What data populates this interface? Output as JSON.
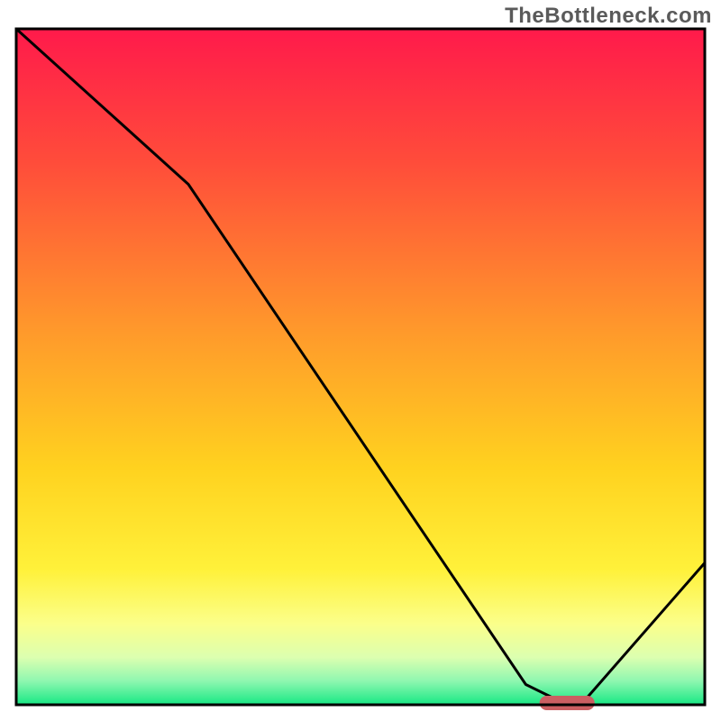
{
  "watermark": "TheBottleneck.com",
  "chart_data": {
    "type": "line",
    "title": "",
    "xlabel": "",
    "ylabel": "",
    "xlim": [
      0,
      100
    ],
    "ylim": [
      0,
      100
    ],
    "x": [
      0,
      25,
      74,
      80,
      82,
      100
    ],
    "values": [
      100,
      77,
      3,
      0,
      0,
      21
    ],
    "marker": {
      "x_start": 76,
      "x_end": 84,
      "y": 0,
      "color": "#cb5f62"
    },
    "gradient_stops": [
      {
        "offset": 0.0,
        "color": "#ff1a4b"
      },
      {
        "offset": 0.2,
        "color": "#ff4d3a"
      },
      {
        "offset": 0.45,
        "color": "#ff9a2b"
      },
      {
        "offset": 0.65,
        "color": "#ffd21f"
      },
      {
        "offset": 0.8,
        "color": "#fff13a"
      },
      {
        "offset": 0.88,
        "color": "#fbff8a"
      },
      {
        "offset": 0.93,
        "color": "#dcffb0"
      },
      {
        "offset": 0.965,
        "color": "#8ef7b0"
      },
      {
        "offset": 1.0,
        "color": "#17e884"
      }
    ],
    "frame": {
      "stroke": "#000000",
      "fill_gradient": true
    }
  }
}
